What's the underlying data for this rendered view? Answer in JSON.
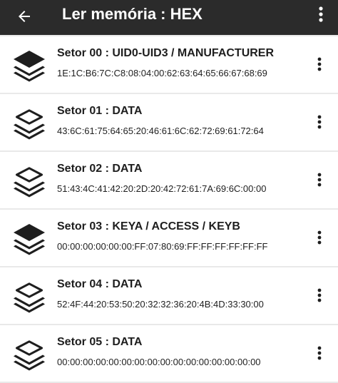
{
  "header": {
    "back_icon": "arrow-back-icon",
    "title": "Ler memória : HEX",
    "menu_icon": "more-vert-icon"
  },
  "sectors": [
    {
      "title": "Setor 00 : UID0-UID3 / MANUFACTURER",
      "hex": "1E:1C:B6:7C:C8:08:04:00:62:63:64:65:66:67:68:69",
      "icon": "layers-filled-icon"
    },
    {
      "title": "Setor 01 : DATA",
      "hex": "43:6C:61:75:64:65:20:46:61:6C:62:72:69:61:72:64",
      "icon": "layers-outline-icon"
    },
    {
      "title": "Setor 02 : DATA",
      "hex": "51:43:4C:41:42:20:2D:20:42:72:61:7A:69:6C:00:00",
      "icon": "layers-outline-icon"
    },
    {
      "title": "Setor 03 : KEYA / ACCESS / KEYB",
      "hex": "00:00:00:00:00:00:FF:07:80:69:FF:FF:FF:FF:FF:FF",
      "icon": "layers-filled-icon"
    },
    {
      "title": "Setor 04 : DATA",
      "hex": "52:4F:44:20:53:50:20:32:32:36:20:4B:4D:33:30:00",
      "icon": "layers-outline-icon"
    },
    {
      "title": "Setor 05 : DATA",
      "hex": "00:00:00:00:00:00:00:00:00:00:00:00:00:00:00:00",
      "icon": "layers-outline-icon"
    }
  ],
  "colors": {
    "appbar": "#2b2b2b",
    "background": "#e9e9e9",
    "row": "#ffffff",
    "text": "#1e1e1e"
  }
}
